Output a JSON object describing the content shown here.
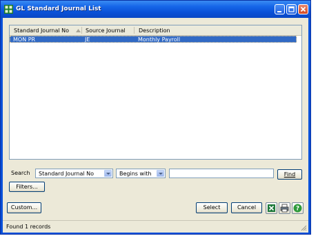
{
  "window": {
    "title": "GL Standard Journal List",
    "accent": "#0a51d9"
  },
  "list": {
    "columns": [
      "Standard Journal No",
      "Source Journal",
      "Description"
    ],
    "rows": [
      {
        "journal_no": "MON PR",
        "source": "JE",
        "description": "Monthly Payroll"
      }
    ],
    "selected_color": "#316ac5"
  },
  "search": {
    "label": "Search",
    "field_value": "Standard Journal No",
    "operator_value": "Begins with",
    "text_value": "",
    "find_label": "Find"
  },
  "buttons": {
    "filters": "Filters...",
    "custom": "Custom...",
    "select": "Select",
    "cancel": "Cancel"
  },
  "icons": {
    "title": "app-grid-icon",
    "export": "excel-export-icon",
    "print": "printer-icon",
    "help": "help-icon"
  },
  "status": {
    "text": "Found 1 records"
  }
}
